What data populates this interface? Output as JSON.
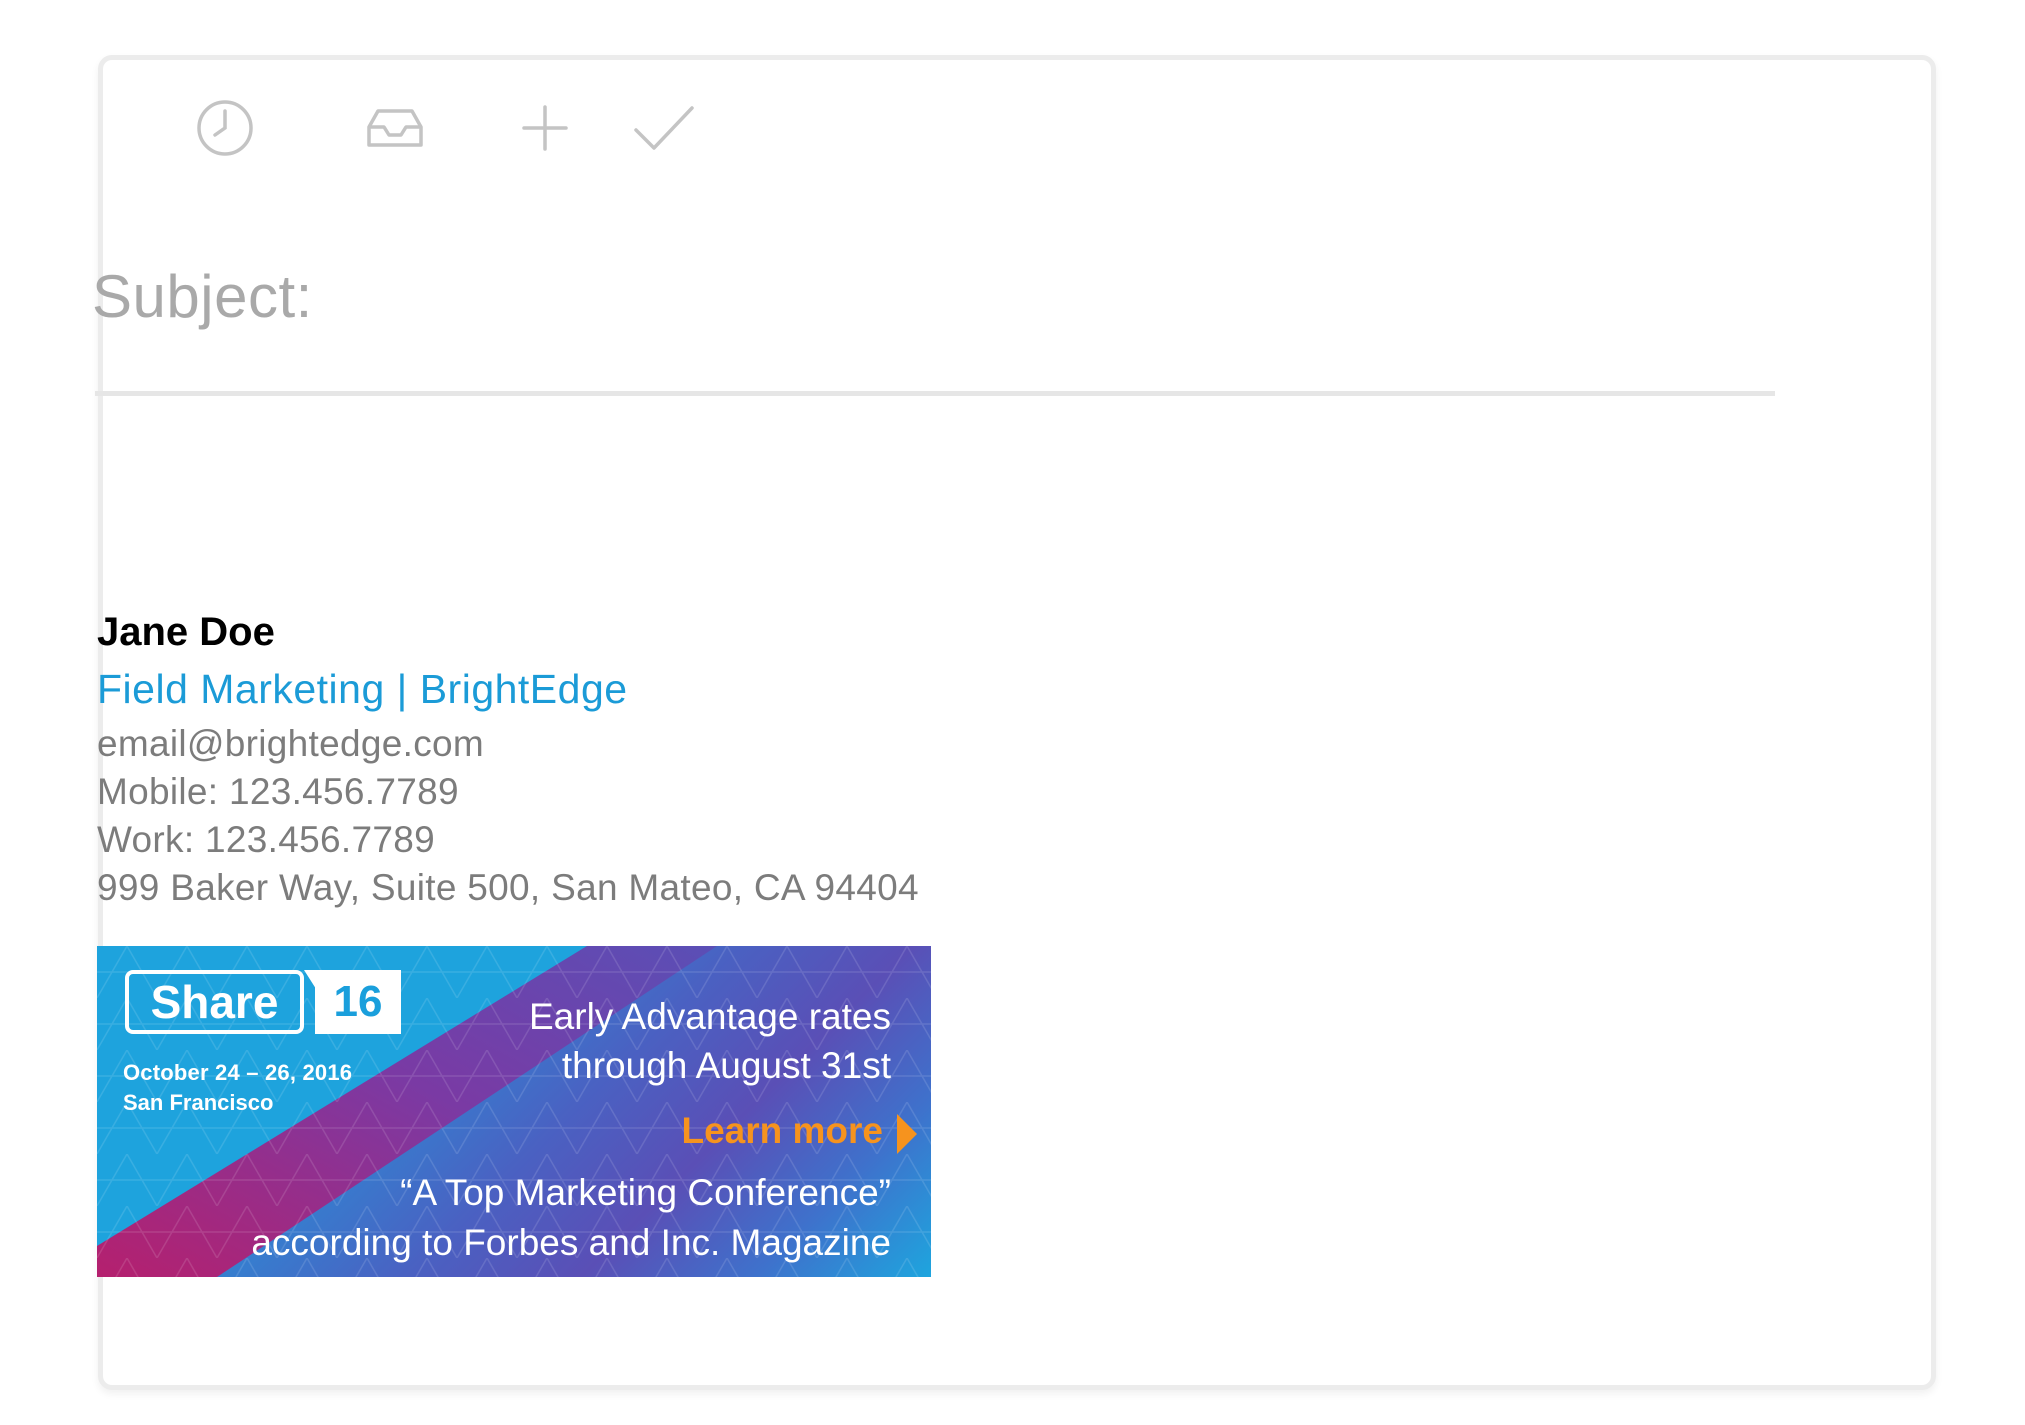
{
  "compose": {
    "toolbar": {
      "icons": [
        "clock-icon",
        "inbox-icon",
        "plus-icon",
        "check-icon"
      ]
    },
    "subject_label": "Subject:"
  },
  "signature": {
    "name": "Jane Doe",
    "title": "Field Marketing | BrightEdge",
    "email": "email@brightedge.com",
    "mobile": "Mobile: 123.456.7789",
    "work": "Work: 123.456.7789",
    "address": "999 Baker Way, Suite 500, San Mateo, CA 94404"
  },
  "banner": {
    "logo_word": "Share",
    "logo_number": "16",
    "dates": "October 24 – 26, 2016",
    "city": "San Francisco",
    "line1": "Early Advantage rates",
    "line2": "through August 31st",
    "cta": "Learn more",
    "quote1": "“A Top Marketing Conference”",
    "quote2": "according to Forbes and Inc. Magazine"
  },
  "colors": {
    "accent": "#1b9bd7",
    "muted_text": "#7c7c7c",
    "cta": "#f6931e",
    "banner_magenta": "#b5206e"
  }
}
